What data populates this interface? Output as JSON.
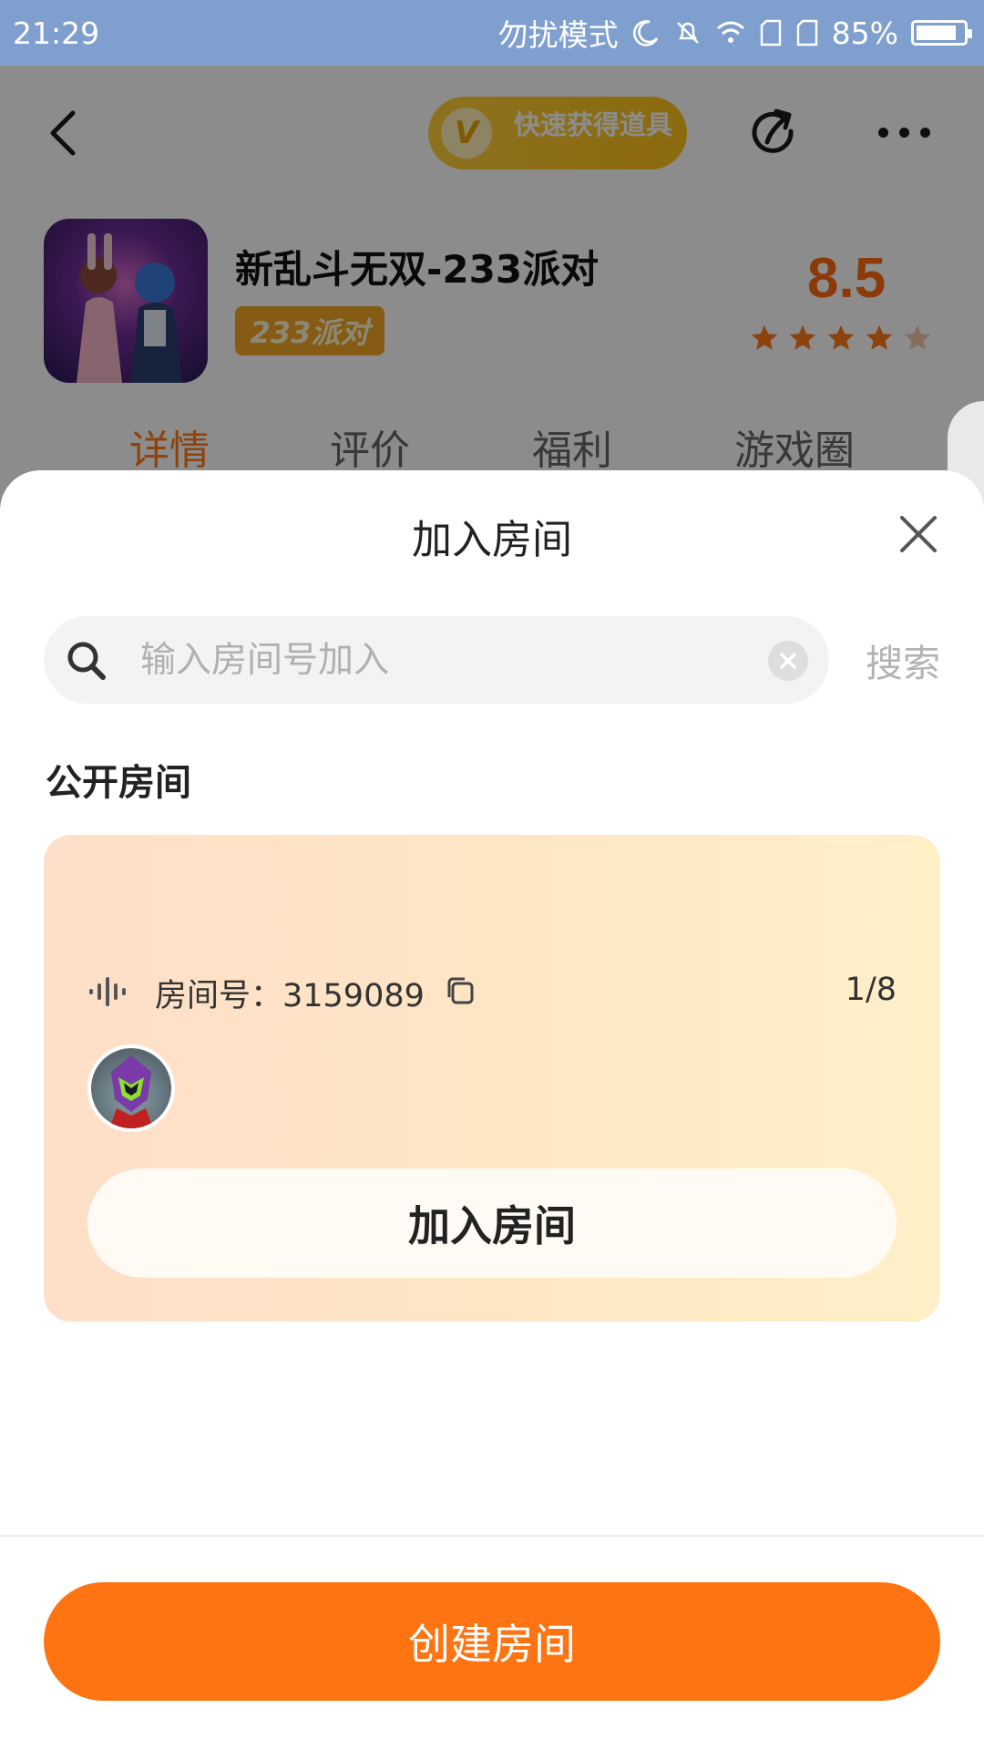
{
  "status_bar": {
    "time": "21:29",
    "mode": "勿扰模式",
    "battery": "85%",
    "battery_level": 0.85
  },
  "header": {
    "promo": "快速获得道具",
    "promo_badge": "V"
  },
  "app": {
    "title": "新乱斗无双-233派对",
    "tag": "233派对",
    "score": "8.5",
    "stars": 4
  },
  "tabs": [
    "详情",
    "评价",
    "福利",
    "游戏圈"
  ],
  "dialog": {
    "title": "加入房间",
    "search_placeholder": "输入房间号加入",
    "search_button": "搜索",
    "section_title": "公开房间",
    "room": {
      "label": "房间号：3159089",
      "count": "1/8",
      "join_label": "加入房间"
    },
    "create_label": "创建房间"
  },
  "colors": {
    "accent": "#ff7412",
    "status_bar": "#7f9fcf"
  }
}
